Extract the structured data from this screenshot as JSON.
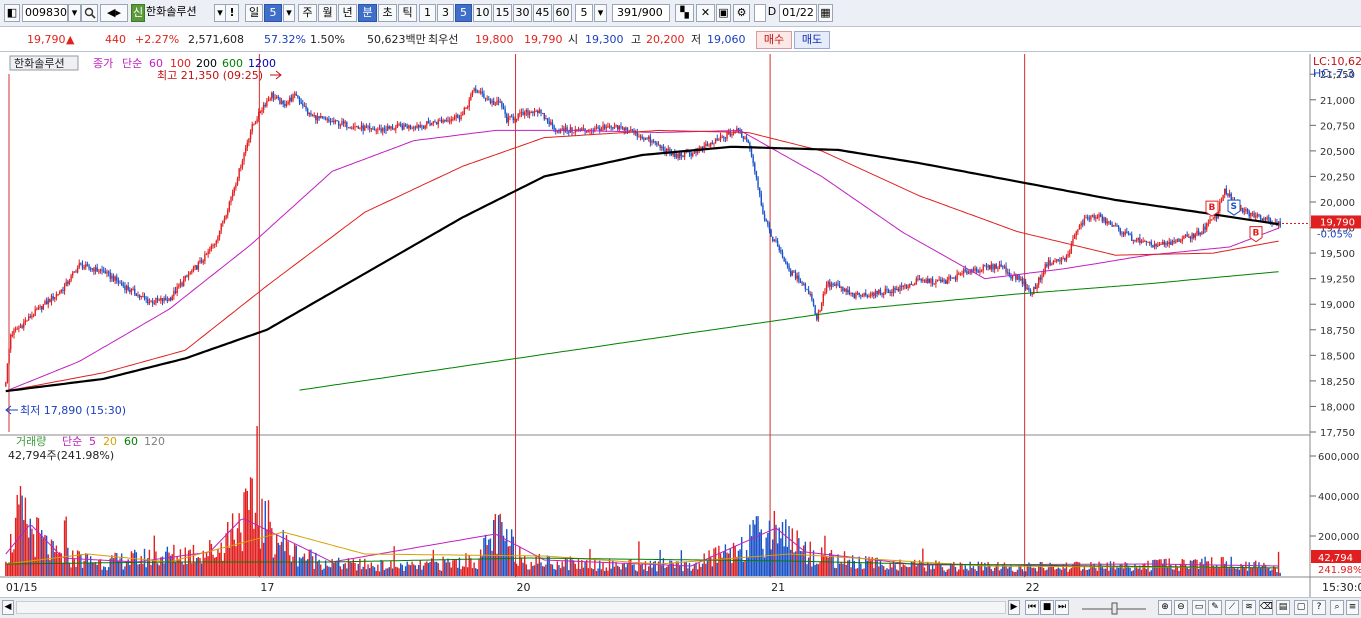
{
  "toolbar": {
    "stock_code": "009830",
    "credit_badge": "신",
    "stock_name": "한화솔루션",
    "alert_label": "!",
    "day_label": "일",
    "day_value": "5",
    "week_label": "주",
    "month_label": "월",
    "year_label": "년",
    "minute_label": "분",
    "second_label": "초",
    "tick_label": "틱",
    "intervals": [
      "1",
      "3",
      "5",
      "10",
      "15",
      "30",
      "45",
      "60"
    ],
    "selected_interval": "5",
    "period_value": "5",
    "count_display": "391",
    "count_total": "/900",
    "d_label": "D",
    "date_value": "01/22"
  },
  "quote": {
    "price": "19,790",
    "change_arrow": "▲",
    "change": "440",
    "change_pct": "+2.27%",
    "volume": "2,571,608",
    "volume_ratio": "57.32%",
    "turnover": "1.50%",
    "amount": "50,623백만",
    "best_ask_label": "최우선",
    "best_ask": "19,800",
    "best_bid": "19,790",
    "open_label": "시",
    "open": "19,300",
    "high_label": "고",
    "high": "20,200",
    "low_label": "저",
    "low": "19,060",
    "buy_button": "매수",
    "sell_button": "매도"
  },
  "chart_data": {
    "type": "candlestick",
    "legend": {
      "name_box": "한화솔루션",
      "price_label": "종가",
      "ma_type": "단순",
      "ma_periods": [
        "60",
        "100",
        "200",
        "600",
        "1200"
      ],
      "ma_colors": [
        "#c020c0",
        "#e02020",
        "#000000",
        "#008000",
        "#0000c0"
      ]
    },
    "high_marker": "최고 21,350 (09:25)",
    "low_marker": "최저 17,890 (15:30)",
    "lc_label": "LC:10,62",
    "hc_label": "HC:-7,3",
    "current_price": "19,790",
    "current_pct": "-0.05%",
    "price_axis": {
      "ticks": [
        "21,250",
        "21,000",
        "20,750",
        "20,500",
        "20,250",
        "20,000",
        "19,750",
        "19,500",
        "19,250",
        "19,000",
        "18,750",
        "18,500",
        "18,250",
        "18,000",
        "17,750"
      ],
      "values": [
        21250,
        21000,
        20750,
        20500,
        20250,
        20000,
        19750,
        19500,
        19250,
        19000,
        18750,
        18500,
        18250,
        18000,
        17750
      ],
      "ylim": [
        17750,
        21350
      ]
    },
    "volume_legend": {
      "label": "거래량",
      "ma_type": "단순",
      "ma_periods": [
        "5",
        "20",
        "60",
        "120"
      ],
      "ma_colors": [
        "#c020c0",
        "#d8a000",
        "#008000",
        "#808080"
      ],
      "info": "42,794주(241.98%)"
    },
    "volume_axis": {
      "ticks": [
        "600,000",
        "400,000",
        "200,000"
      ],
      "values": [
        600000,
        400000,
        200000
      ],
      "ylim": [
        0,
        680000
      ]
    },
    "current_volume": "42,794",
    "current_volume_pct": "241.98%",
    "date_labels": [
      "01/15",
      "17",
      "20",
      "21",
      "22"
    ],
    "session_dividers": [
      "01/17",
      "01/20",
      "01/21",
      "01/22"
    ],
    "time_label": "15:30:0",
    "price_path_anchors": [
      [
        0,
        18260
      ],
      [
        3,
        18700
      ],
      [
        10,
        18800
      ],
      [
        20,
        18950
      ],
      [
        35,
        19150
      ],
      [
        45,
        19380
      ],
      [
        60,
        19320
      ],
      [
        75,
        19150
      ],
      [
        88,
        19020
      ],
      [
        100,
        19050
      ],
      [
        110,
        19250
      ],
      [
        120,
        19420
      ],
      [
        128,
        19600
      ],
      [
        135,
        19900
      ],
      [
        142,
        20250
      ],
      [
        150,
        20700
      ],
      [
        158,
        20950
      ],
      [
        163,
        21050
      ],
      [
        170,
        20950
      ],
      [
        178,
        21050
      ],
      [
        186,
        20850
      ],
      [
        195,
        20800
      ],
      [
        210,
        20750
      ],
      [
        225,
        20700
      ],
      [
        240,
        20730
      ],
      [
        255,
        20750
      ],
      [
        268,
        20800
      ],
      [
        280,
        20850
      ],
      [
        287,
        21100
      ],
      [
        292,
        21050
      ],
      [
        300,
        20950
      ],
      [
        303,
        20980
      ],
      [
        307,
        20800
      ],
      [
        315,
        20850
      ],
      [
        325,
        20900
      ],
      [
        338,
        20700
      ],
      [
        355,
        20700
      ],
      [
        368,
        20720
      ],
      [
        380,
        20720
      ],
      [
        395,
        20600
      ],
      [
        410,
        20450
      ],
      [
        420,
        20480
      ],
      [
        428,
        20530
      ],
      [
        438,
        20620
      ],
      [
        448,
        20700
      ],
      [
        455,
        20600
      ],
      [
        460,
        20250
      ],
      [
        464,
        19900
      ],
      [
        468,
        19700
      ],
      [
        474,
        19550
      ],
      [
        480,
        19320
      ],
      [
        488,
        19220
      ],
      [
        494,
        19060
      ],
      [
        497,
        18850
      ],
      [
        503,
        19200
      ],
      [
        510,
        19170
      ],
      [
        520,
        19080
      ],
      [
        530,
        19100
      ],
      [
        545,
        19140
      ],
      [
        560,
        19230
      ],
      [
        575,
        19220
      ],
      [
        590,
        19330
      ],
      [
        600,
        19350
      ],
      [
        610,
        19380
      ],
      [
        616,
        19280
      ],
      [
        622,
        19250
      ],
      [
        628,
        19100
      ],
      [
        632,
        19200
      ],
      [
        638,
        19400
      ],
      [
        650,
        19450
      ],
      [
        656,
        19700
      ],
      [
        662,
        19850
      ],
      [
        670,
        19850
      ],
      [
        680,
        19750
      ],
      [
        690,
        19650
      ],
      [
        700,
        19580
      ],
      [
        712,
        19580
      ],
      [
        722,
        19650
      ],
      [
        732,
        19700
      ],
      [
        742,
        19870
      ],
      [
        747,
        20130
      ],
      [
        752,
        20000
      ],
      [
        756,
        19930
      ],
      [
        764,
        19870
      ],
      [
        774,
        19830
      ],
      [
        781,
        19790
      ]
    ],
    "ma_anchors": {
      "ma60": [
        [
          0,
          18150
        ],
        [
          45,
          18440
        ],
        [
          100,
          18950
        ],
        [
          150,
          19580
        ],
        [
          200,
          20300
        ],
        [
          250,
          20600
        ],
        [
          300,
          20700
        ],
        [
          350,
          20700
        ],
        [
          400,
          20680
        ],
        [
          450,
          20700
        ],
        [
          500,
          20250
        ],
        [
          550,
          19700
        ],
        [
          600,
          19250
        ],
        [
          650,
          19350
        ],
        [
          700,
          19480
        ],
        [
          750,
          19560
        ],
        [
          781,
          19750
        ]
      ],
      "ma100": [
        [
          0,
          18150
        ],
        [
          60,
          18330
        ],
        [
          110,
          18550
        ],
        [
          160,
          19180
        ],
        [
          220,
          19900
        ],
        [
          280,
          20350
        ],
        [
          330,
          20630
        ],
        [
          400,
          20700
        ],
        [
          455,
          20680
        ],
        [
          500,
          20500
        ],
        [
          560,
          20060
        ],
        [
          620,
          19710
        ],
        [
          680,
          19480
        ],
        [
          740,
          19500
        ],
        [
          781,
          19620
        ]
      ],
      "ma200": [
        [
          0,
          18150
        ],
        [
          60,
          18270
        ],
        [
          110,
          18470
        ],
        [
          160,
          18750
        ],
        [
          220,
          19300
        ],
        [
          280,
          19850
        ],
        [
          330,
          20250
        ],
        [
          390,
          20460
        ],
        [
          445,
          20540
        ],
        [
          510,
          20510
        ],
        [
          560,
          20380
        ],
        [
          620,
          20200
        ],
        [
          680,
          20020
        ],
        [
          740,
          19880
        ],
        [
          781,
          19780
        ]
      ],
      "ma600": [
        [
          180,
          18160
        ],
        [
          300,
          18440
        ],
        [
          420,
          18720
        ],
        [
          520,
          18950
        ],
        [
          620,
          19100
        ],
        [
          700,
          19200
        ],
        [
          781,
          19320
        ]
      ]
    },
    "session_bar_ranges": [
      [
        0,
        156
      ],
      [
        156,
        313
      ],
      [
        313,
        469
      ],
      [
        469,
        625
      ],
      [
        625,
        781
      ]
    ],
    "volume_profile": [
      [
        0,
        80000
      ],
      [
        8,
        350000
      ],
      [
        30,
        120000
      ],
      [
        60,
        80000
      ],
      [
        130,
        150000
      ],
      [
        140,
        300000
      ],
      [
        152,
        380000
      ],
      [
        160,
        300000
      ],
      [
        175,
        140000
      ],
      [
        200,
        70000
      ],
      [
        250,
        55000
      ],
      [
        290,
        95000
      ],
      [
        300,
        260000
      ],
      [
        320,
        90000
      ],
      [
        360,
        70000
      ],
      [
        420,
        55000
      ],
      [
        469,
        260000
      ],
      [
        475,
        300000
      ],
      [
        490,
        140000
      ],
      [
        520,
        80000
      ],
      [
        560,
        60000
      ],
      [
        620,
        50000
      ],
      [
        700,
        60000
      ],
      [
        745,
        80000
      ],
      [
        781,
        42794
      ]
    ],
    "volume_ma5": [
      [
        0,
        110000
      ],
      [
        15,
        260000
      ],
      [
        35,
        90000
      ],
      [
        80,
        70000
      ],
      [
        125,
        120000
      ],
      [
        145,
        290000
      ],
      [
        160,
        230000
      ],
      [
        200,
        70000
      ],
      [
        300,
        210000
      ],
      [
        330,
        80000
      ],
      [
        420,
        50000
      ],
      [
        472,
        240000
      ],
      [
        490,
        120000
      ],
      [
        560,
        55000
      ],
      [
        700,
        60000
      ],
      [
        781,
        50000
      ]
    ],
    "volume_ma20": [
      [
        0,
        60000
      ],
      [
        50,
        110000
      ],
      [
        100,
        70000
      ],
      [
        170,
        220000
      ],
      [
        220,
        110000
      ],
      [
        330,
        100000
      ],
      [
        400,
        60000
      ],
      [
        480,
        110000
      ],
      [
        520,
        90000
      ],
      [
        600,
        50000
      ],
      [
        781,
        40000
      ]
    ],
    "volume_ma60": [
      [
        0,
        60000
      ],
      [
        100,
        70000
      ],
      [
        200,
        70000
      ],
      [
        320,
        90000
      ],
      [
        480,
        75000
      ],
      [
        560,
        60000
      ],
      [
        781,
        40000
      ]
    ]
  },
  "bottom": {
    "arrow_left": "◀",
    "arrow_right": "▶"
  }
}
